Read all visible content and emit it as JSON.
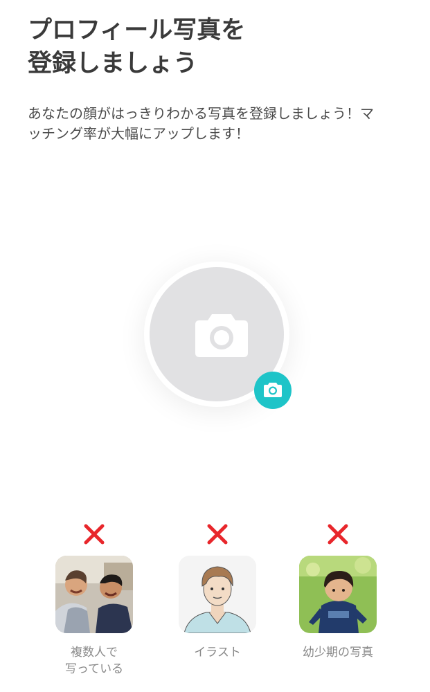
{
  "header": {
    "title_line1": "プロフィール写真を",
    "title_line2": "登録しましょう"
  },
  "description": {
    "line1": "あなたの顔がはっきりわかる写真を登録しましょう！マ",
    "line2": "ッチング率が大幅にアップします！"
  },
  "avatar": {
    "placeholder_icon": "camera-icon",
    "badge_icon": "camera-icon",
    "badge_color": "#1ec4c8",
    "placeholder_color": "#e1e1e3"
  },
  "examples": {
    "mark_icon": "x-mark-icon",
    "mark_color": "#e8262b",
    "items": [
      {
        "label_line1": "複数人で",
        "label_line2": "写っている"
      },
      {
        "label_line1": "イラスト",
        "label_line2": ""
      },
      {
        "label_line1": "幼少期の写真",
        "label_line2": ""
      }
    ]
  }
}
